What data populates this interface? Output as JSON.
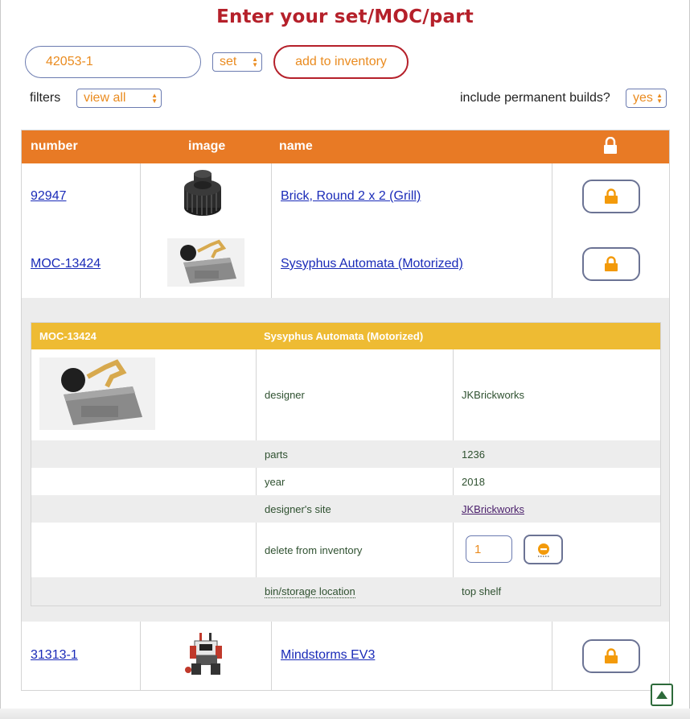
{
  "header": {
    "title": "Enter your set/MOC/part",
    "search_value": "42053-1",
    "type_select": "set",
    "add_button": "add to inventory",
    "filters_label": "filters",
    "filters_select": "view all",
    "permanent_label": "include permanent builds?",
    "permanent_select": "yes"
  },
  "table": {
    "columns": [
      "number",
      "image",
      "name"
    ],
    "lock_header_icon": "lock-icon",
    "rows": [
      {
        "number": "92947",
        "name": "Brick, Round 2 x 2 (Grill)",
        "image": "grill-brick-image"
      },
      {
        "number": "MOC-13424",
        "name": "Sysyphus Automata (Motorized)",
        "image": "sisyphus-automata-image"
      },
      {
        "number": "31313-1",
        "name": "Mindstorms EV3",
        "image": "mindstorms-robot-image"
      }
    ]
  },
  "detail": {
    "number": "MOC-13424",
    "name": "Sysyphus Automata (Motorized)",
    "designer_label": "designer",
    "designer_value": "JKBrickworks",
    "parts_label": "parts",
    "parts_value": "1236",
    "year_label": "year",
    "year_value": "2018",
    "site_label": "designer's site",
    "site_value": "JKBrickworks",
    "delete_label": "delete from inventory",
    "delete_qty": "1",
    "bin_label": "bin/storage location",
    "bin_value": "top shelf"
  },
  "colors": {
    "header_orange": "#e87a25",
    "detail_yellow": "#eebb33",
    "accent_orange": "#ea8b1f",
    "title_red": "#b5202a",
    "link_blue": "#1a2bb8",
    "detail_text_green": "#2f5130"
  }
}
